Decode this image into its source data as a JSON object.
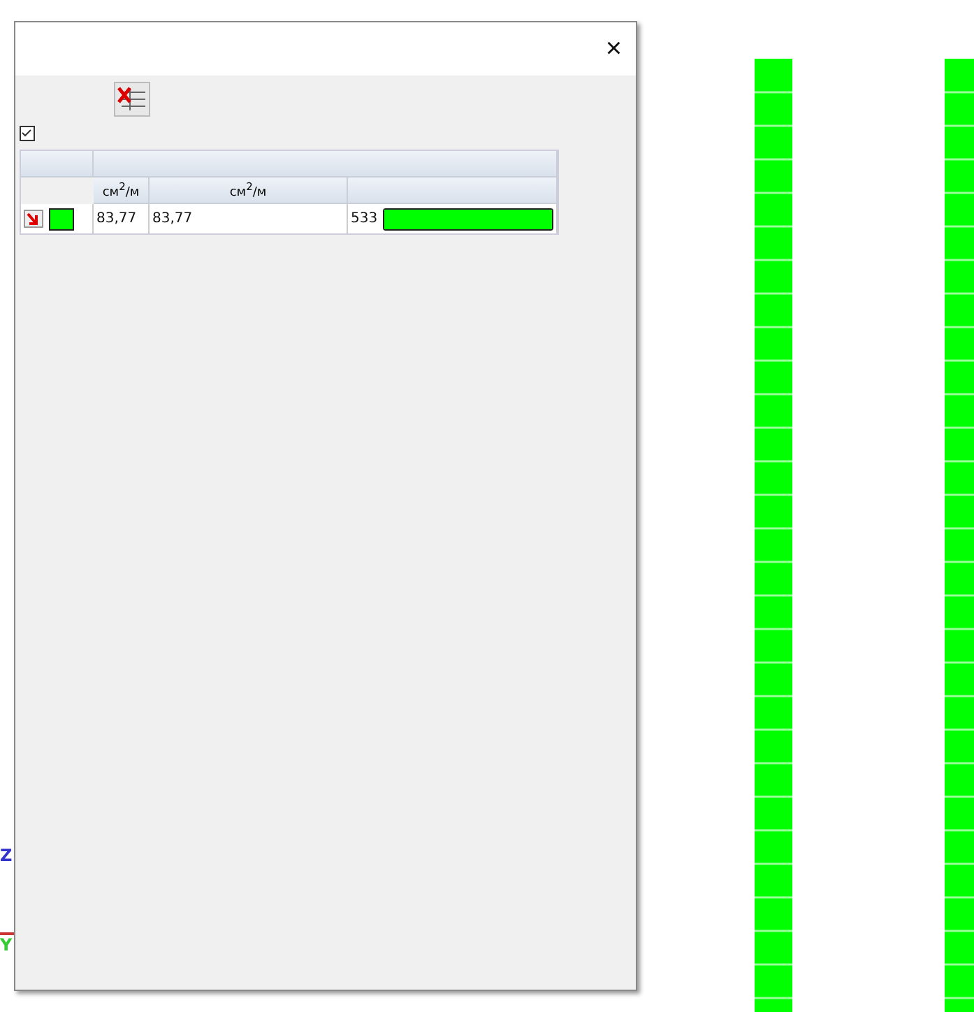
{
  "dialog": {
    "close": "×",
    "table": {
      "units": [
        "см$^{2}$/м",
        "см$^{2}$/м"
      ],
      "rows": [
        {
          "checked": true,
          "color": "#00ff00",
          "value_1": "83,77",
          "value_2": "83,77",
          "count": "533",
          "level": 1
        }
      ]
    }
  },
  "axes": {
    "z": "Z",
    "y": "Y"
  }
}
